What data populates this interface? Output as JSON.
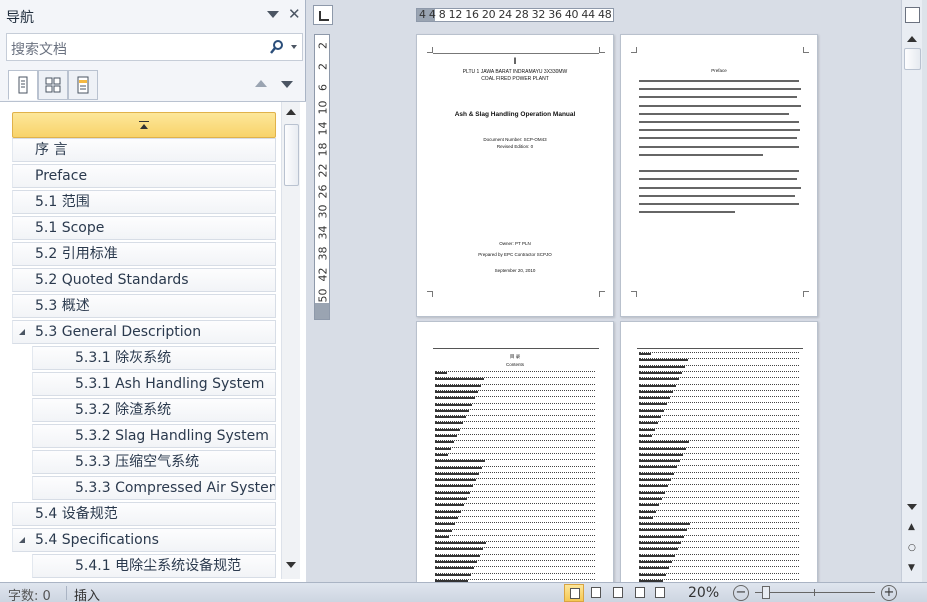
{
  "nav": {
    "title": "导航",
    "search_placeholder": "搜索文档",
    "items": [
      {
        "label": "序   言",
        "level": 1,
        "expandable": false
      },
      {
        "label": "Preface",
        "level": 1,
        "expandable": false
      },
      {
        "label": "5.1 范围",
        "level": 1,
        "expandable": false
      },
      {
        "label": "5.1 Scope",
        "level": 1,
        "expandable": false
      },
      {
        "label": "5.2 引用标准",
        "level": 1,
        "expandable": false
      },
      {
        "label": "5.2 Quoted Standards",
        "level": 1,
        "expandable": false
      },
      {
        "label": "5.3 概述",
        "level": 1,
        "expandable": false
      },
      {
        "label": "5.3 General Description",
        "level": 1,
        "expandable": true
      },
      {
        "label": "5.3.1 除灰系统",
        "level": 2,
        "expandable": false
      },
      {
        "label": "5.3.1 Ash Handling System",
        "level": 2,
        "expandable": false
      },
      {
        "label": "5.3.2 除渣系统",
        "level": 2,
        "expandable": false
      },
      {
        "label": "5.3.2 Slag Handling System",
        "level": 2,
        "expandable": false
      },
      {
        "label": "5.3.3 压缩空气系统",
        "level": 2,
        "expandable": false
      },
      {
        "label": "5.3.3 Compressed Air System",
        "level": 2,
        "expandable": false
      },
      {
        "label": "5.4 设备规范",
        "level": 1,
        "expandable": false
      },
      {
        "label": "5.4 Specifications",
        "level": 1,
        "expandable": true
      },
      {
        "label": "5.4.1 电除尘系统设备规范",
        "level": 2,
        "expandable": false
      }
    ]
  },
  "ruler": {
    "horizontal": "4  4  8 12 16 20 24 28 32 36 40 44 48",
    "vertical": [
      "2",
      "2",
      "6",
      "10",
      "14",
      "18",
      "22",
      "26",
      "30",
      "34",
      "38",
      "42",
      "50"
    ]
  },
  "page1": {
    "header_mark": "I",
    "plant_line1": "PLTU 1 JAWA BARAT INDRAMAYU 3X330MW",
    "plant_line2": "COAL FIRED POWER PLANT",
    "manual_title": "Ash & Slag Handling Operation Manual",
    "doc_number": "Document Number: SCP-OM43",
    "revision": "Revised Edition: 0",
    "owner": "Owner: PT PLN",
    "prepared_by": "Prepared by EPC Contractor SCPJO",
    "date": "September 20, 2010"
  },
  "page2": {
    "heading": "Preface"
  },
  "page3": {
    "heading_cn": "目  录",
    "heading_en": "Contents"
  },
  "status": {
    "word_count": "字数: 0",
    "mode": "插入",
    "zoom": "20%",
    "zoom_minus": "−",
    "zoom_plus": "+"
  },
  "colors": {
    "accent_selected": "#f8d36a",
    "nav_bg": "#f3f5f9",
    "doc_bg": "#d8dde6"
  }
}
